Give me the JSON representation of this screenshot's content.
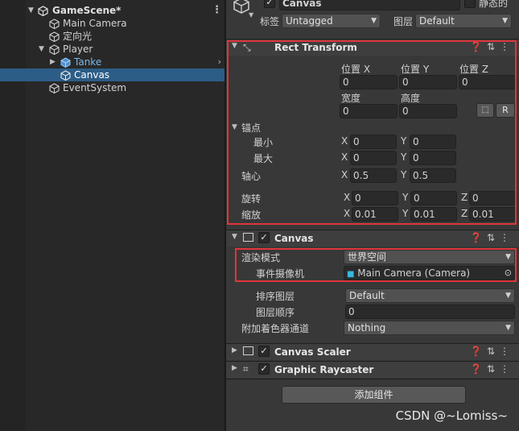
{
  "hierarchy": {
    "scene": "GameScene*",
    "items": [
      {
        "label": "Main Camera"
      },
      {
        "label": "定向光"
      },
      {
        "label": "Player"
      },
      {
        "label": "Tanke"
      },
      {
        "label": "Canvas"
      },
      {
        "label": "EventSystem"
      }
    ]
  },
  "inspector": {
    "object_name": "Canvas",
    "static_label": "静态的",
    "tag_label": "标签",
    "tag_value": "Untagged",
    "layer_label": "图层",
    "layer_value": "Default",
    "rect_transform": {
      "title": "Rect Transform",
      "pos_x_label": "位置 X",
      "pos_y_label": "位置 Y",
      "pos_z_label": "位置 Z",
      "pos_x": "0",
      "pos_y": "0",
      "pos_z": "0",
      "width_label": "宽度",
      "height_label": "高度",
      "width": "0",
      "height": "0",
      "r_button": "R",
      "anchors_label": "锚点",
      "min_label": "最小",
      "max_label": "最大",
      "min_x": "0",
      "min_y": "0",
      "max_x": "0",
      "max_y": "0",
      "pivot_label": "轴心",
      "pivot_x": "0.5",
      "pivot_y": "0.5",
      "rotation_label": "旋转",
      "rot_x": "0",
      "rot_y": "0",
      "rot_z": "0",
      "scale_label": "缩放",
      "scale_x": "0.01",
      "scale_y": "0.01",
      "scale_z": "0.01",
      "axis_x": "X",
      "axis_y": "Y",
      "axis_z": "Z"
    },
    "canvas": {
      "title": "Canvas",
      "render_mode_label": "渲染模式",
      "render_mode_value": "世界空间",
      "event_camera_label": "事件摄像机",
      "event_camera_value": "Main Camera (Camera)",
      "sorting_layer_label": "排序图层",
      "sorting_layer_value": "Default",
      "order_label": "图层顺序",
      "order_value": "0",
      "shader_channels_label": "附加着色器通道",
      "shader_channels_value": "Nothing"
    },
    "canvas_scaler": {
      "title": "Canvas Scaler"
    },
    "graphic_raycaster": {
      "title": "Graphic Raycaster"
    },
    "add_component": "添加组件"
  },
  "watermark": "CSDN @~Lomiss~",
  "colors": {
    "selection": "#2c5d87",
    "highlight_box": "#e0353a",
    "prefab_text": "#7cb7e8"
  }
}
